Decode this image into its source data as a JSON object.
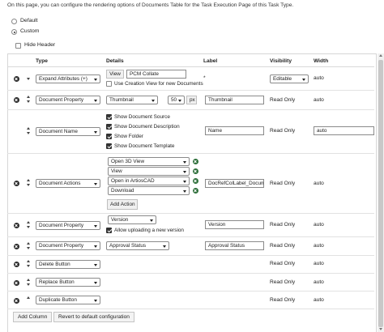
{
  "intro_text": "On this page, you can configure the rendering options of Documents Table for the Task Execution Page of this Task Type.",
  "options": {
    "default_label": "Default",
    "custom_label": "Custom",
    "selected": "Custom"
  },
  "hide_header": {
    "label": "Hide Header",
    "checked": false
  },
  "columns_header": {
    "type": "Type",
    "details": "Details",
    "label": "Label",
    "visibility": "Visibility",
    "width": "Width"
  },
  "rows": {
    "expand": {
      "type": "Expand Attributes (+)",
      "view_btn": "View",
      "view_value": "PCM Collate",
      "creation_view_label": "Use Creation View for new Documents",
      "label": "*",
      "visibility": "Editable",
      "width": "auto"
    },
    "docprop1": {
      "type": "Document Property",
      "detail": "Thumbnail",
      "size": "50",
      "unit": "px",
      "label": "Thumbnail",
      "visibility": "Read Only",
      "width": "auto"
    },
    "docname": {
      "type": "Document Name",
      "checks": [
        "Show Document Source",
        "Show Document Description",
        "Show Folder",
        "Show Document Template"
      ],
      "label": "Name",
      "visibility": "Read Only",
      "width": "auto"
    },
    "actions": {
      "type": "Document Actions",
      "items": [
        "Open 3D View",
        "View",
        "Open in ArtiosCAD",
        "Download"
      ],
      "add_action": "Add Action",
      "label": "DocRefColLabel_Docum",
      "visibility": "Read Only",
      "width": "auto"
    },
    "docprop2": {
      "type": "Document Property",
      "detail": "Version",
      "allow_label": "Allow uploading a new version",
      "label": "Version",
      "visibility": "Read Only",
      "width": "auto"
    },
    "docprop3": {
      "type": "Document Property",
      "detail": "Approval Status",
      "label": "Approval Status",
      "visibility": "Read Only",
      "width": "auto"
    },
    "delete": {
      "type": "Delete Button",
      "visibility": "Read Only",
      "width": "auto"
    },
    "replace": {
      "type": "Replace Button",
      "visibility": "Read Only",
      "width": "auto"
    },
    "duplicate": {
      "type": "Duplicate Button",
      "visibility": "Read Only",
      "width": "auto"
    }
  },
  "footer": {
    "add_column": "Add Column",
    "revert": "Revert to default configuration"
  }
}
